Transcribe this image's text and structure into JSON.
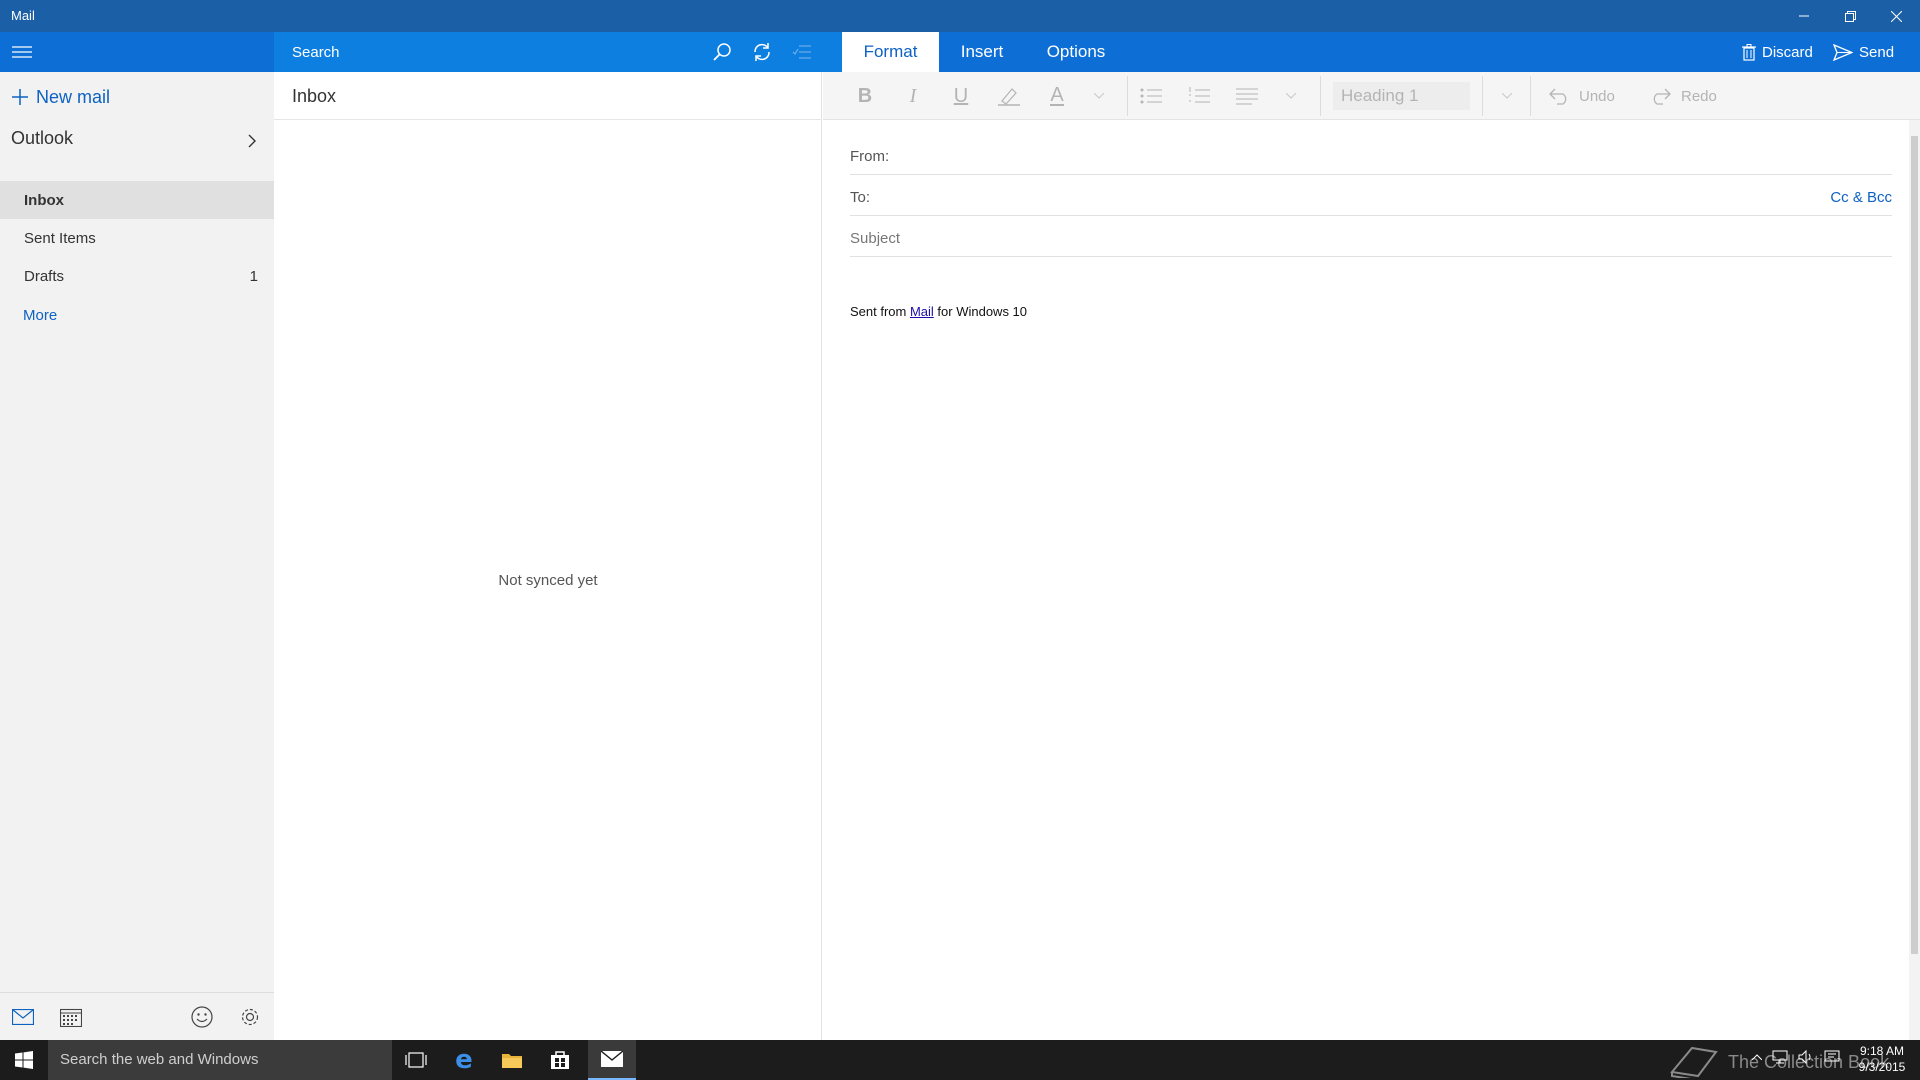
{
  "window": {
    "title": "Mail"
  },
  "header": {
    "search_placeholder": "Search",
    "tabs": [
      {
        "label": "Format",
        "active": true
      },
      {
        "label": "Insert",
        "active": false
      },
      {
        "label": "Options",
        "active": false
      }
    ],
    "discard_label": "Discard",
    "send_label": "Send"
  },
  "nav": {
    "new_mail_label": "New mail",
    "account_name": "Outlook",
    "folders": [
      {
        "label": "Inbox",
        "count": ""
      },
      {
        "label": "Sent Items",
        "count": ""
      },
      {
        "label": "Drafts",
        "count": "1"
      }
    ],
    "more_label": "More"
  },
  "list": {
    "title": "Inbox",
    "empty_message": "Not synced yet"
  },
  "compose": {
    "heading_style": "Heading 1",
    "undo_label": "Undo",
    "redo_label": "Redo",
    "from_label": "From:",
    "to_label": "To:",
    "cc_bcc_label": "Cc & Bcc",
    "subject_placeholder": "Subject",
    "signature": {
      "prefix": "Sent from ",
      "link": "Mail",
      "suffix": " for Windows 10"
    }
  },
  "taskbar": {
    "search_placeholder": "Search the web and Windows",
    "watermark": "The Collection Book",
    "time": "9:18 AM",
    "date": "9/3/2015"
  },
  "colors": {
    "accent": "#0d6fd6",
    "titlebar": "#1b5fa7",
    "link": "#0d62c2"
  }
}
